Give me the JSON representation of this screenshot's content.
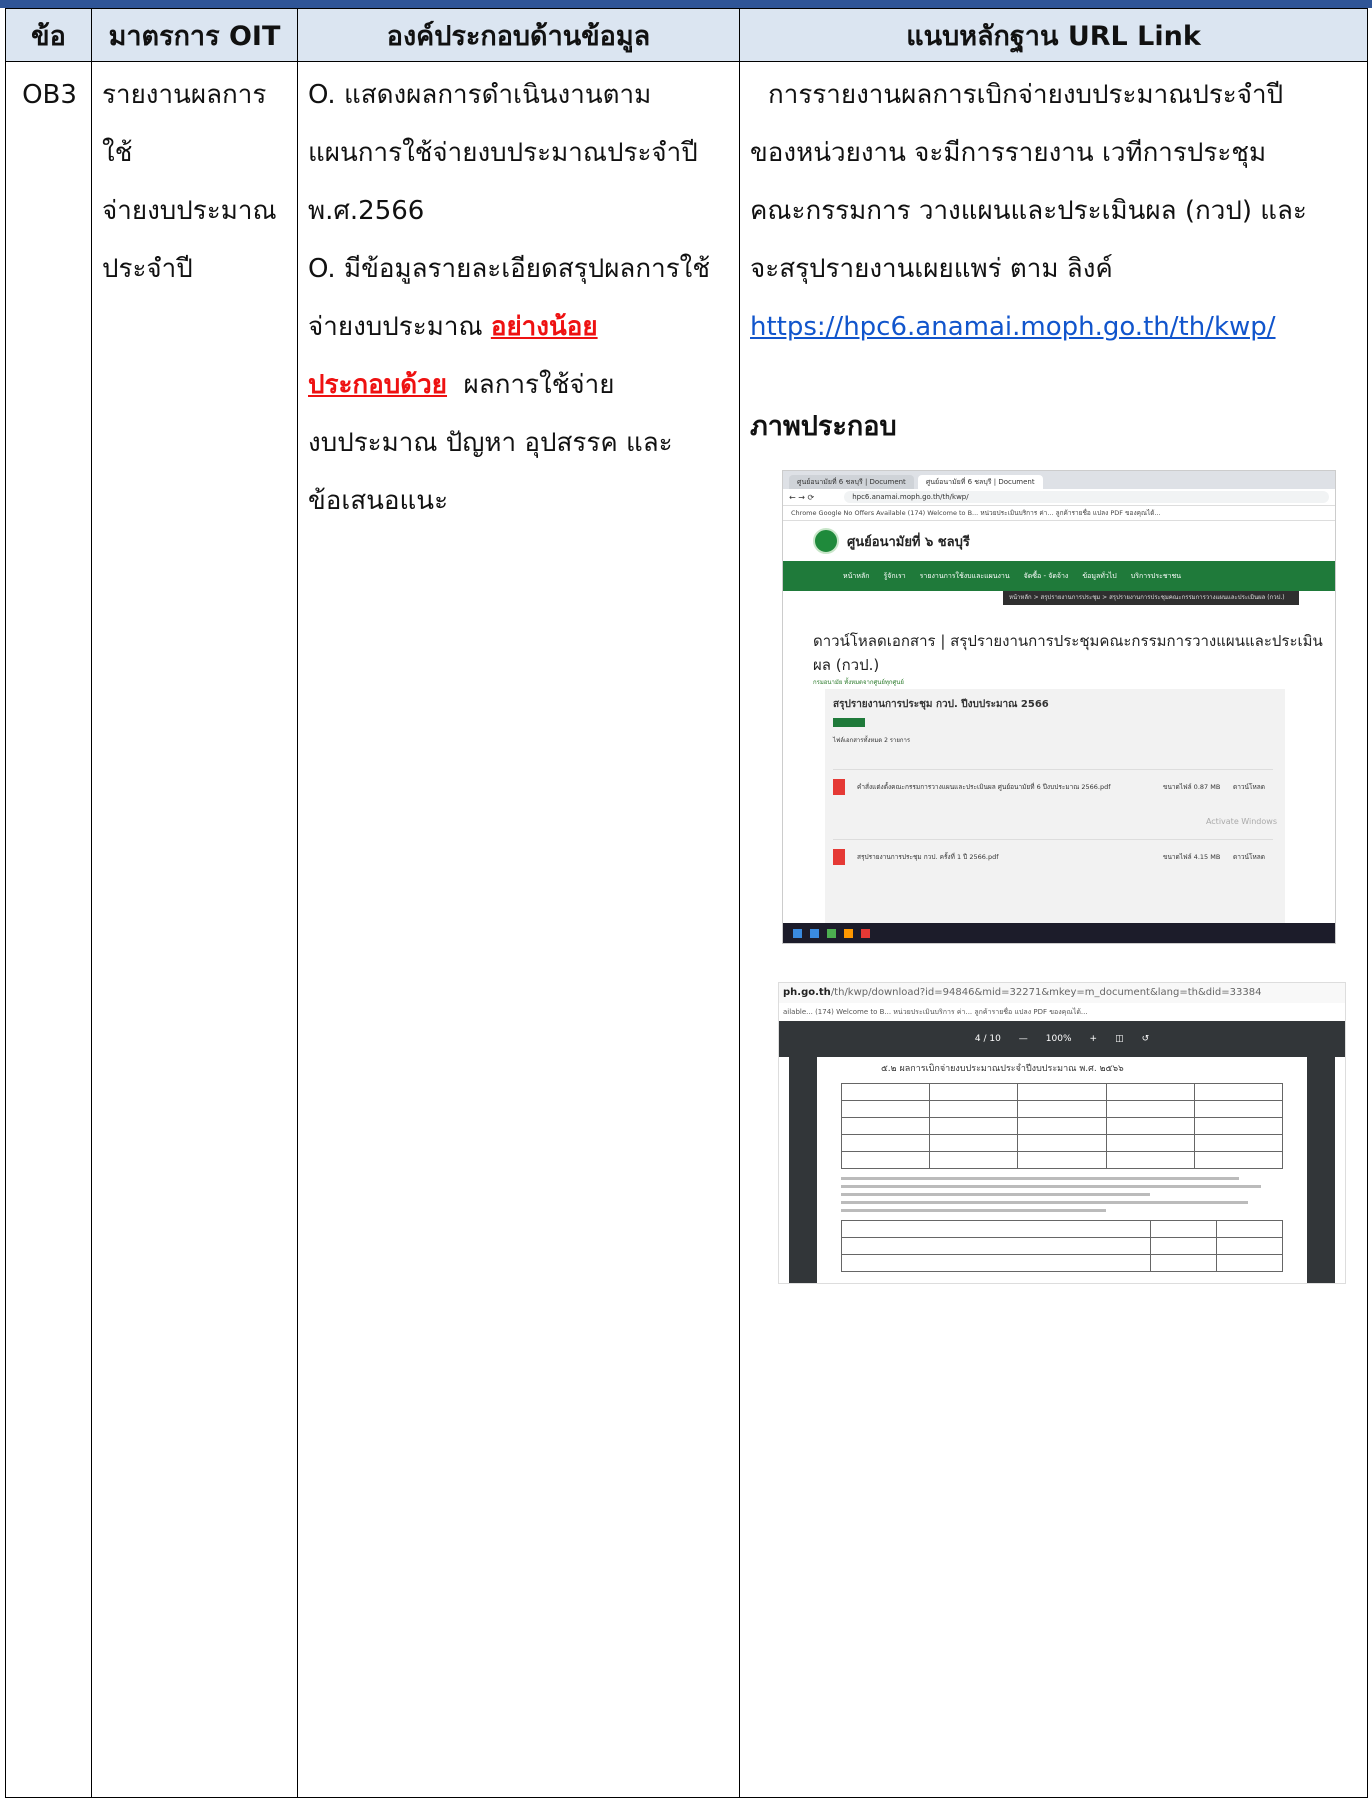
{
  "table": {
    "headers": [
      "ข้อ",
      "มาตรการ OIT",
      "องค์ประกอบด้านข้อมูล",
      "แนบหลักฐาน URL Link"
    ],
    "row": {
      "no": "OB3",
      "measure_lines": [
        "รายงานผลการใช้",
        "จ่ายงบประมาณ",
        "ประจำปี"
      ],
      "component": {
        "line1": "O. แสดงผลการดำเนินงานตาม",
        "line2": "แผนการใช้จ่ายงบประมาณประจำปี",
        "line3": "พ.ศ.2566",
        "line4": "O. มีข้อมูลรายละเอียดสรุปผลการใช้",
        "line5_pre": "จ่ายงบประมาณ ",
        "line5_red": "อย่างน้อย",
        "line6_red": "ประกอบด้วย",
        "line6_post": "  ผลการใช้จ่าย",
        "line7": "งบประมาณ ปัญหา อุปสรรค และ",
        "line8": "ข้อเสนอแนะ"
      },
      "evidence": {
        "line1": "การรายงานผลการเบิกจ่ายงบประมาณประจำปี",
        "line2": "ของหน่วยงาน จะมีการรายงาน เวทีการประชุม",
        "line3": "คณะกรรมการ วางแผนและประเมินผล (กวป) และ",
        "line4": "จะสรุปรายงานเผยแพร่ ตาม ลิงค์",
        "url": "https://hpc6.anamai.moph.go.th/th/kwp/",
        "figure_label": "ภาพประกอบ"
      }
    }
  },
  "screenshot1": {
    "tab1": "ศูนย์อนามัยที่ 6 ชลบุรี | Document",
    "tab2": "ศูนย์อนามัยที่ 6 ชลบุรี | Document",
    "address": "hpc6.anamai.moph.go.th/th/kwp/",
    "bookmarks": "Chrome   Google   No Offers Available   (174) Welcome to B...   หน่วยประเมินบริการ ค่า...   ลูกค้ารายชื่อ   แปลง PDF ของคุณได้...",
    "site_name": "ศูนย์อนามัยที่ ๖ ชลบุรี",
    "nav": [
      "หน้าหลัก",
      "รู้จักเรา",
      "รายงานการใช้งบและแผนงาน",
      "จัดซื้อ - จัดจ้าง",
      "ข้อมูลทั่วไป",
      "บริการประชาชน"
    ],
    "breadcrumb": "หน้าหลัก > สรุปรายงานการประชุม > สรุปรายงานการประชุมคณะกรรมการวางแผนและประเมินผล (กวป.)",
    "page_title": "ดาวน์โหลดเอกสาร | สรุปรายงานการประชุมคณะกรรมการวางแผนและประเมินผล (กวป.)",
    "page_sub": "กรมอนามัย ทั้งหมดจากศูนย์ทุกศูนย์",
    "section": "สรุปรายงานการประชุม กวป. ปีงบประมาณ 2566",
    "count": "ไฟล์เอกสารทั้งหมด 2 รายการ",
    "file1": "คำสั่งแต่งตั้งคณะกรรมการวางแผนและประเมินผล ศูนย์อนามัยที่ 6 ปีงบประมาณ 2566.pdf",
    "file2": "สรุปรายงานการประชุม กวป. ครั้งที่ 1 ปี 2566.pdf",
    "file_meta1": "ขนาดไฟล์ 0.87 MB",
    "file_meta2": "ขนาดไฟล์ 4.15 MB",
    "dl_label": "ดาวน์โหลด",
    "watermark": "Activate Windows"
  },
  "screenshot2": {
    "url_bold": "ph.go.th",
    "url_rest": "/th/kwp/download?id=94846&mid=32271&mkey=m_document&lang=th&did=33384",
    "bookmarks": "ailable...   (174) Welcome to B...   หน่วยประเมินบริการ ค่า...   ลูกค้ารายชื่อ   แปลง PDF ของคุณได้...",
    "page_indicator": "4  /  10",
    "zoom": "100%",
    "doc_heading": "๕.๒ ผลการเบิกจ่ายงบประมาณประจำปีงบประมาณ พ.ศ. ๒๕๖๖"
  }
}
